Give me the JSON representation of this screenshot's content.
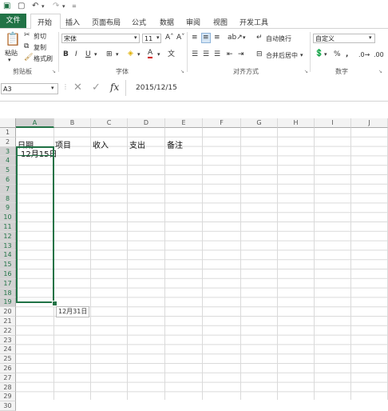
{
  "ribbon_tabs": [
    "文件",
    "开始",
    "插入",
    "页面布局",
    "公式",
    "数据",
    "审阅",
    "视图",
    "开发工具"
  ],
  "clipboard": {
    "paste": "粘贴",
    "cut": "剪切",
    "copy": "复制",
    "painter": "格式刷",
    "group": "剪贴板"
  },
  "font": {
    "name": "宋体",
    "size": "11",
    "bold": "B",
    "italic": "I",
    "underline": "U",
    "group": "字体"
  },
  "alignment": {
    "wrap": "自动换行",
    "merge": "合并后居中",
    "group": "对齐方式"
  },
  "number": {
    "format": "自定义",
    "percent": "%",
    "comma": ",",
    "group": "数字"
  },
  "formula_bar": {
    "name_box": "A3",
    "fx": "fx",
    "value": "2015/12/15"
  },
  "columns": [
    "A",
    "B",
    "C",
    "D",
    "E",
    "F",
    "G",
    "H",
    "I",
    "J"
  ],
  "rows": [
    "1",
    "2",
    "3",
    "4",
    "5",
    "6",
    "7",
    "8",
    "9",
    "10",
    "11",
    "12",
    "13",
    "14",
    "15",
    "16",
    "17",
    "18",
    "19",
    "20",
    "21",
    "22",
    "23",
    "24",
    "25",
    "26",
    "27",
    "28",
    "29",
    "30"
  ],
  "cells": {
    "a2": "日期",
    "b2": "项目",
    "c2": "收入",
    "d2": "支出",
    "e2": "备注",
    "a3": "12月15日"
  },
  "fill_tooltip": "12月31日",
  "colors": {
    "accent": "#217346",
    "selection": "#217346"
  }
}
